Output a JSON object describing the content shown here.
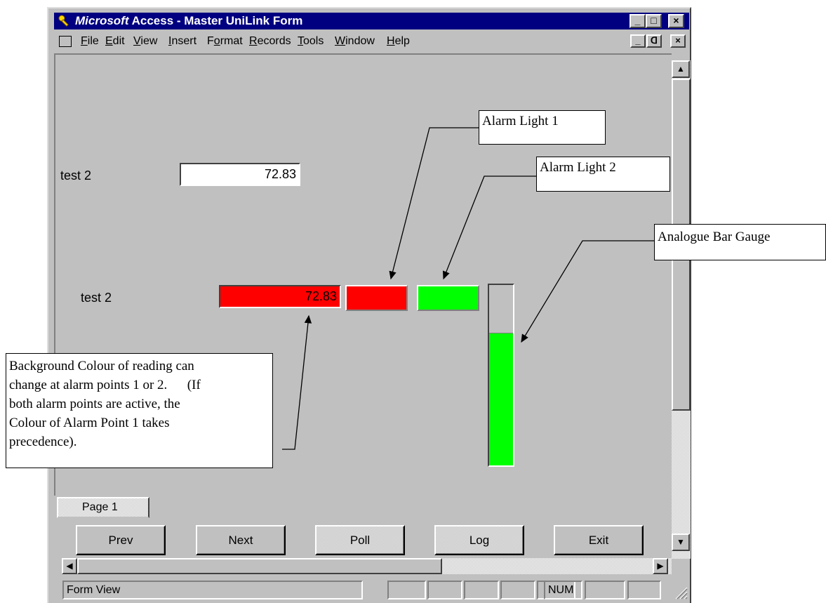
{
  "window": {
    "title_brand": "Microsoft",
    "title_rest": " Access - Master UniLink Form",
    "caption_buttons": [
      "_",
      "□",
      "×"
    ]
  },
  "menu": {
    "items": [
      "File",
      "Edit",
      "View",
      "Insert",
      "Format",
      "Records",
      "Tools",
      "Window",
      "Help"
    ],
    "mnemonics": [
      "F",
      "E",
      "V",
      "I",
      "o",
      "R",
      "T",
      "W",
      "H"
    ],
    "mdi_buttons": [
      "_",
      "ᗡ",
      "×"
    ]
  },
  "form": {
    "label1": "test 2",
    "value1": "72.83",
    "label2": "test 2",
    "value2": "72.83",
    "alarm_light_1_color": "#ff0000",
    "alarm_light_2_color": "#00ff00",
    "reading_bg_color": "#ff0000",
    "gauge_fill_color": "#00ff00",
    "gauge_level_fraction": 0.73
  },
  "tab": {
    "label": "Page 1"
  },
  "buttons": {
    "prev": "Prev",
    "next": "Next",
    "poll": "Poll",
    "log": "Log",
    "exit": "Exit"
  },
  "status": {
    "mode": "Form View",
    "num": "NUM"
  },
  "callouts": {
    "alarm1": "Alarm Light 1",
    "alarm2": "Alarm Light 2",
    "gauge": "Analogue Bar Gauge",
    "background_lines": [
      "Background Colour of reading can",
      "change at alarm points 1 or 2.      (If",
      "both alarm points are active, the",
      "Colour of Alarm Point 1 takes",
      "precedence)."
    ]
  },
  "icons": {
    "title": "key-icon",
    "form": "form-icon",
    "scroll_up": "arrow-up-icon",
    "scroll_down": "arrow-down-icon",
    "scroll_left": "arrow-left-icon",
    "scroll_right": "arrow-right-icon",
    "resize": "resize-grip-icon"
  }
}
